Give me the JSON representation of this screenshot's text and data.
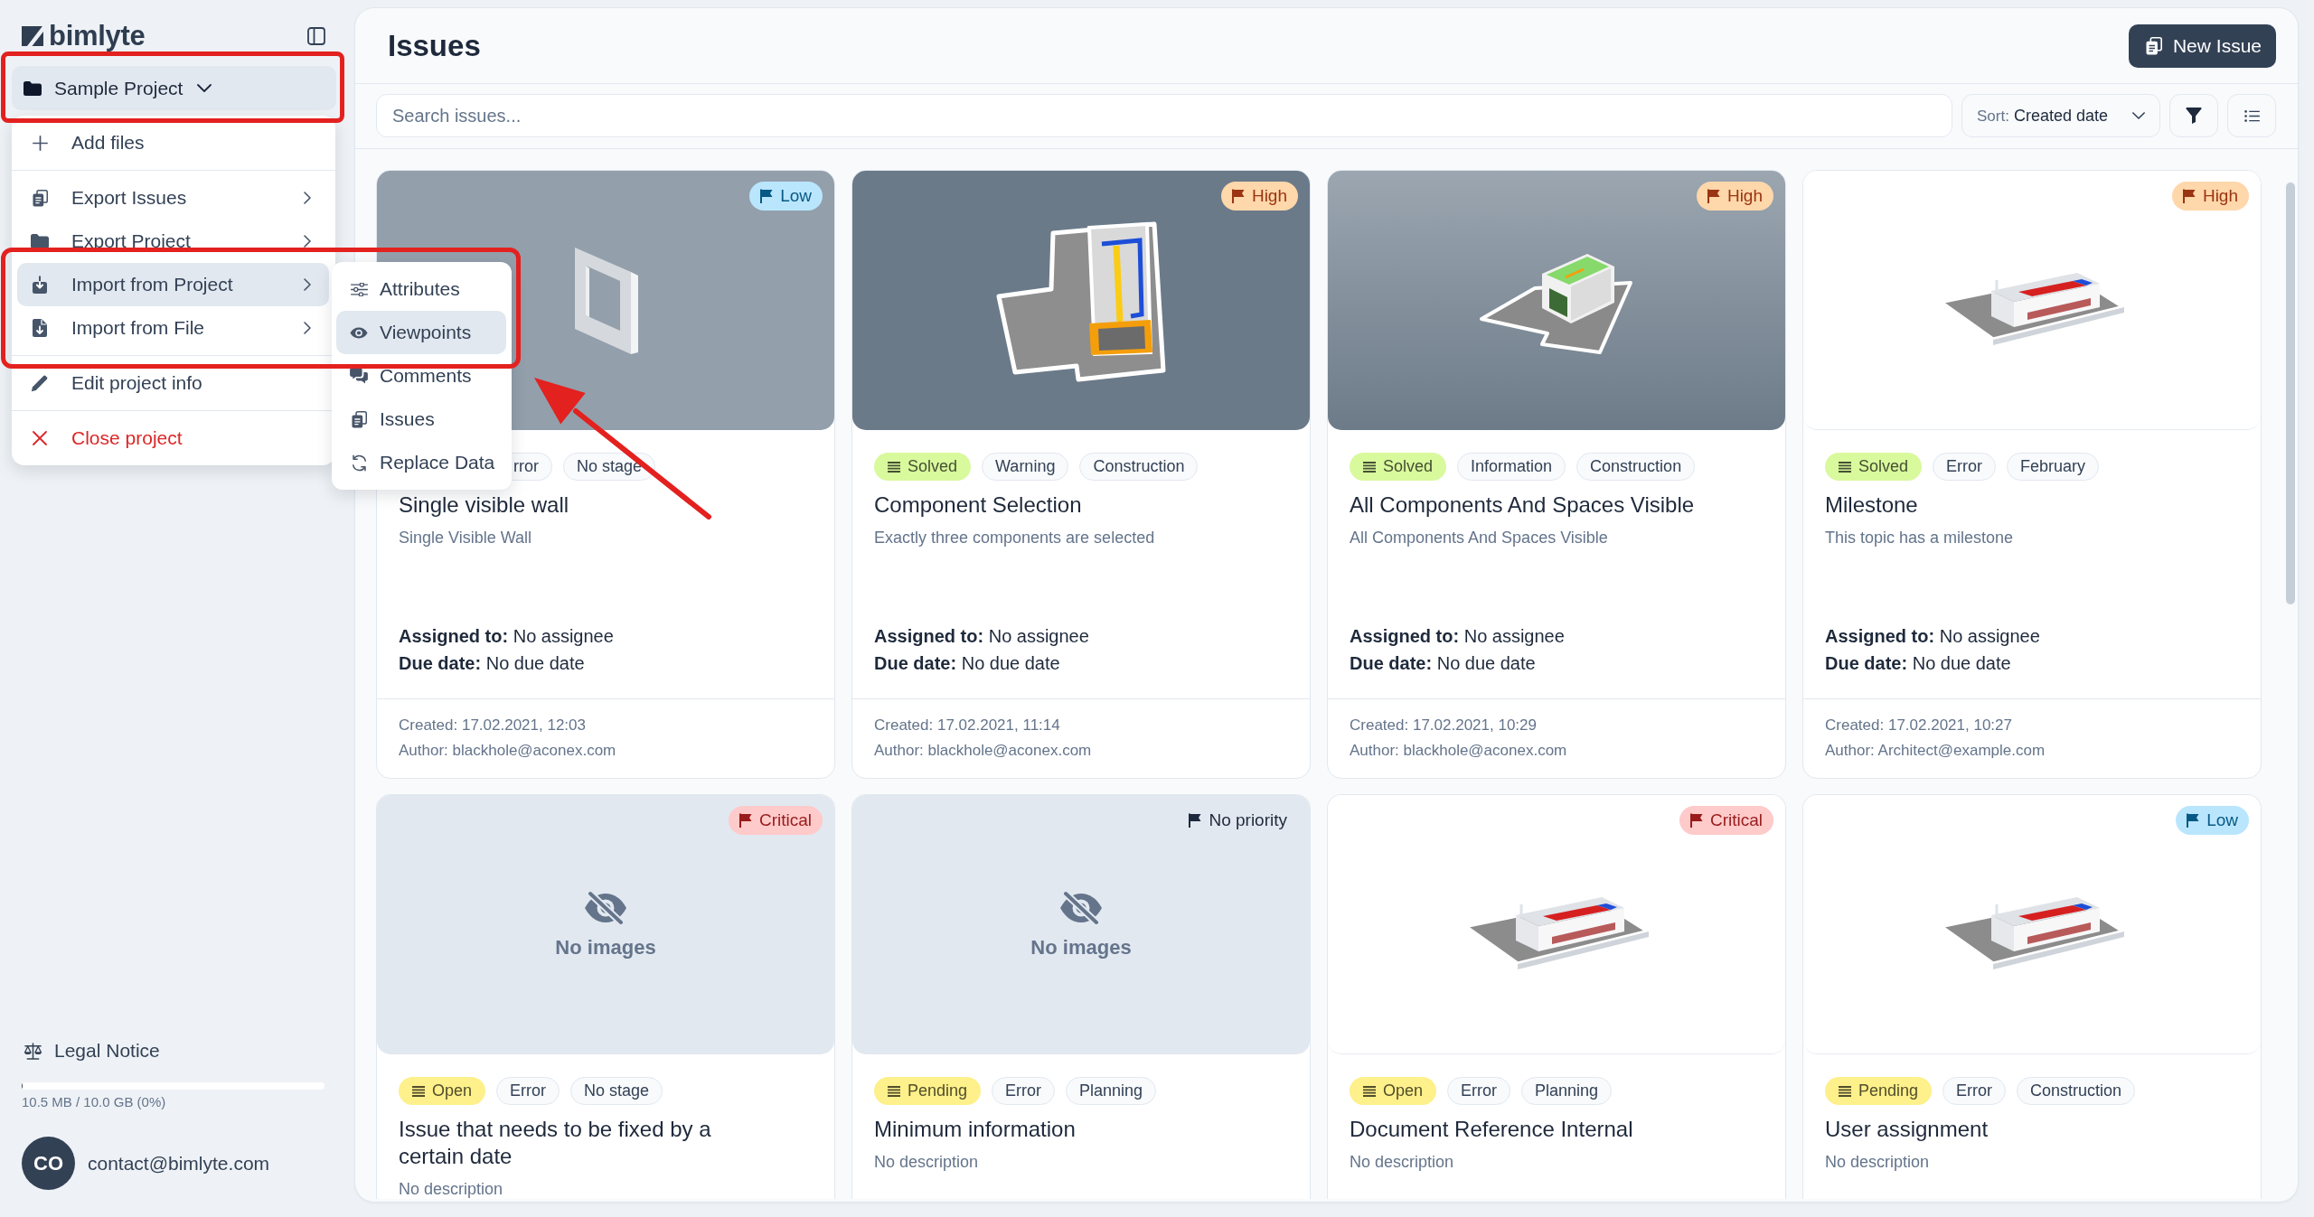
{
  "sidebar": {
    "brand": "bimlyte",
    "project": {
      "label": "Sample Project",
      "expanded": true
    },
    "menu": {
      "sections": [
        [
          {
            "label": "Add files",
            "kind": "action",
            "selected": false
          }
        ],
        [
          {
            "label": "Export Issues",
            "kind": "submenu",
            "selected": false
          },
          {
            "label": "Export Project",
            "kind": "submenu",
            "selected": false
          },
          {
            "label": "Import from Project",
            "kind": "submenu",
            "selected": true,
            "children": [
              {
                "label": "Attributes",
                "selected": false
              },
              {
                "label": "Viewpoints",
                "selected": true
              },
              {
                "label": "Comments",
                "selected": false
              },
              {
                "label": "Issues",
                "selected": false
              },
              {
                "label": "Replace Data",
                "selected": false
              }
            ]
          },
          {
            "label": "Import from File",
            "kind": "submenu",
            "selected": false
          }
        ],
        [
          {
            "label": "Edit project info",
            "kind": "action",
            "selected": false
          }
        ],
        [
          {
            "label": "Close project",
            "kind": "danger",
            "selected": false
          }
        ]
      ]
    },
    "legal": "Legal Notice",
    "storage": {
      "level": 0.001,
      "text": "10.5 MB / 10.0 GB (0%)"
    },
    "user": {
      "initials": "CO",
      "email": "contact@bimlyte.com"
    }
  },
  "header": {
    "title": "Issues",
    "new_button": "New Issue"
  },
  "toolbar": {
    "search": {
      "placeholder": "Search issues..."
    },
    "sort": {
      "label": "Sort:",
      "value": "Created date"
    }
  },
  "issues": [
    {
      "thumbnail": {
        "kind": "wall"
      },
      "priority": {
        "kind": "low",
        "text": "Low"
      },
      "tags": [
        {
          "kind": "label",
          "text": "rror",
          "covered": true
        },
        {
          "kind": "label",
          "text": "No stage",
          "covered": false
        }
      ],
      "title": "Single visible wall",
      "description": "Single Visible Wall",
      "assigned": "**Assigned to:** No assignee",
      "due": "**Due date:** No due date",
      "created": "Created: 17.02.2021, 12:03",
      "author": "Author: blackhole@aconex.com"
    },
    {
      "thumbnail": {
        "kind": "plan"
      },
      "priority": {
        "kind": "high",
        "text": "High"
      },
      "tags": [
        {
          "kind": "status",
          "text": "Solved",
          "color": "#d9f99d",
          "covered": false
        },
        {
          "kind": "label",
          "text": "Warning",
          "covered": false
        },
        {
          "kind": "label",
          "text": "Construction",
          "covered": false
        }
      ],
      "title": "Component Selection",
      "description": "Exactly three components are selected",
      "assigned": "**Assigned to:** No assignee",
      "due": "**Due date:** No due date",
      "created": "Created: 17.02.2021, 11:14",
      "author": "Author: blackhole@aconex.com"
    },
    {
      "thumbnail": {
        "kind": "model"
      },
      "priority": {
        "kind": "high",
        "text": "High"
      },
      "tags": [
        {
          "kind": "status",
          "text": "Solved",
          "color": "#d9f99d",
          "covered": false
        },
        {
          "kind": "label",
          "text": "Information",
          "covered": false
        },
        {
          "kind": "label",
          "text": "Construction",
          "covered": false
        }
      ],
      "title": "All Components And Spaces Visible",
      "description": "All Components And Spaces Visible",
      "assigned": "**Assigned to:** No assignee",
      "due": "**Due date:** No due date",
      "created": "Created: 17.02.2021, 10:29",
      "author": "Author: blackhole@aconex.com"
    },
    {
      "thumbnail": {
        "kind": "building"
      },
      "priority": {
        "kind": "high",
        "text": "High"
      },
      "tags": [
        {
          "kind": "status",
          "text": "Solved",
          "color": "#d9f99d",
          "covered": false
        },
        {
          "kind": "label",
          "text": "Error",
          "covered": false
        },
        {
          "kind": "label",
          "text": "February",
          "covered": false
        }
      ],
      "title": "Milestone",
      "description": "This topic has a milestone",
      "assigned": "**Assigned to:** No assignee",
      "due": "**Due date:** No due date",
      "created": "Created: 17.02.2021, 10:27",
      "author": "Author: Architect@example.com"
    },
    {
      "thumbnail": {
        "kind": "none",
        "text": "No images"
      },
      "priority": {
        "kind": "critical",
        "text": "Critical"
      },
      "tags": [
        {
          "kind": "status",
          "text": "Open",
          "color": "#fef08a",
          "covered": false
        },
        {
          "kind": "label",
          "text": "Error",
          "covered": false
        },
        {
          "kind": "label",
          "text": "No stage",
          "covered": false
        }
      ],
      "title": "Issue that needs to be fixed by a certain date",
      "description": "No description"
    },
    {
      "thumbnail": {
        "kind": "none",
        "text": "No images"
      },
      "priority": {
        "kind": "none",
        "text": "No priority"
      },
      "tags": [
        {
          "kind": "status",
          "text": "Pending",
          "color": "#fef08a",
          "covered": false
        },
        {
          "kind": "label",
          "text": "Error",
          "covered": false
        },
        {
          "kind": "label",
          "text": "Planning",
          "covered": false
        }
      ],
      "title": "Minimum information",
      "description": "No description"
    },
    {
      "thumbnail": {
        "kind": "building"
      },
      "priority": {
        "kind": "critical",
        "text": "Critical"
      },
      "tags": [
        {
          "kind": "status",
          "text": "Open",
          "color": "#fef08a",
          "covered": false
        },
        {
          "kind": "label",
          "text": "Error",
          "covered": false
        },
        {
          "kind": "label",
          "text": "Planning",
          "covered": false
        }
      ],
      "title": "Document Reference Internal",
      "description": "No description"
    },
    {
      "thumbnail": {
        "kind": "building"
      },
      "priority": {
        "kind": "low",
        "text": "Low"
      },
      "tags": [
        {
          "kind": "status",
          "text": "Pending",
          "color": "#fef08a",
          "covered": false
        },
        {
          "kind": "label",
          "text": "Error",
          "covered": false
        },
        {
          "kind": "label",
          "text": "Construction",
          "covered": false
        }
      ],
      "title": "User assignment",
      "description": "No description"
    }
  ]
}
